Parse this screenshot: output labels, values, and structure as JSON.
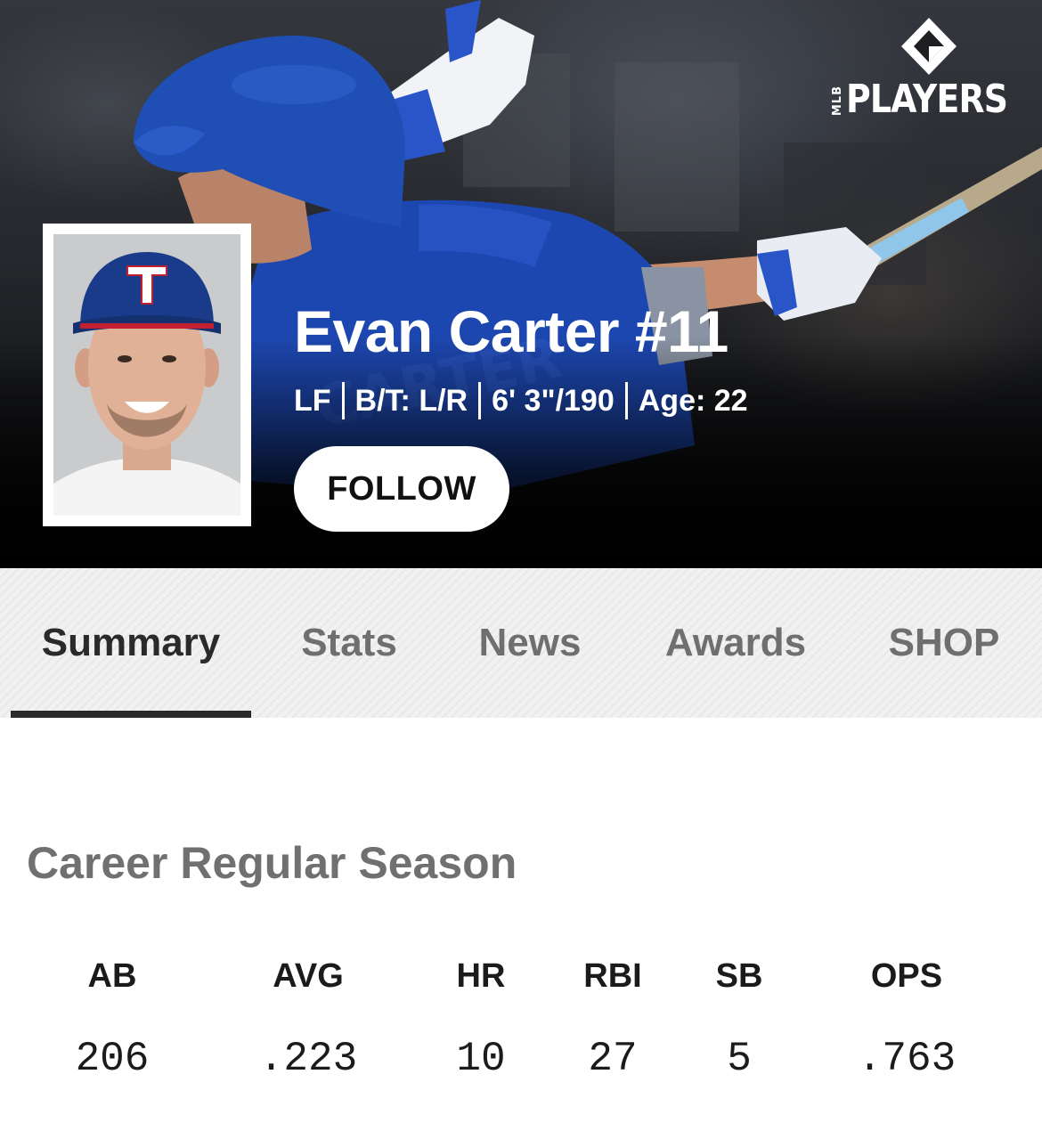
{
  "brand": {
    "small_text": "MLB",
    "word": "PLAYERS",
    "logo_icon": "players-diamond-icon"
  },
  "player": {
    "name": "Evan Carter #11",
    "position": "LF",
    "bats_throws": "B/T: L/R",
    "height_weight": "6' 3\"/190",
    "age": "Age: 22",
    "follow_label": "FOLLOW",
    "helmet_color": "#1f4fb5",
    "jersey_color": "#1d47b0"
  },
  "tabs": [
    {
      "label": "Summary",
      "active": true
    },
    {
      "label": "Stats",
      "active": false
    },
    {
      "label": "News",
      "active": false
    },
    {
      "label": "Awards",
      "active": false
    },
    {
      "label": "SHOP",
      "active": false
    }
  ],
  "career": {
    "title": "Career Regular Season",
    "stats": [
      {
        "label": "AB",
        "value": "206"
      },
      {
        "label": "AVG",
        "value": ".223"
      },
      {
        "label": "HR",
        "value": "10"
      },
      {
        "label": "RBI",
        "value": "27"
      },
      {
        "label": "SB",
        "value": "5"
      },
      {
        "label": "OPS",
        "value": ".763"
      }
    ]
  }
}
